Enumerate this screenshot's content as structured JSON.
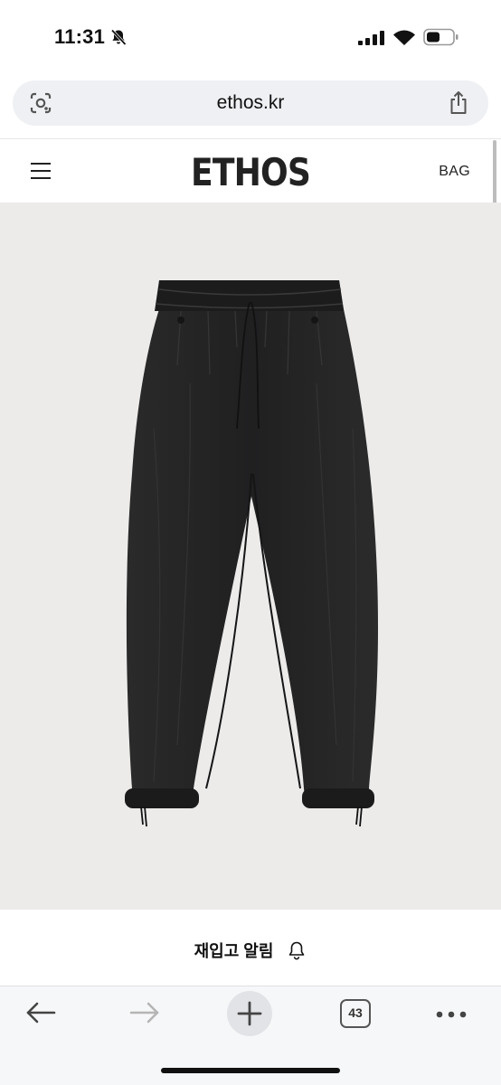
{
  "status_bar": {
    "time": "11:31"
  },
  "browser": {
    "url": "ethos.kr",
    "open_tabs": "43"
  },
  "site": {
    "logo": "ETHOS",
    "bag_label": "BAG"
  },
  "product": {
    "restock_label": "재입고 알림"
  },
  "colors": {
    "product_bg": "#ecebea",
    "toolbar_bg": "#f6f7f8",
    "url_bar_bg": "#eef0f3"
  },
  "icons": [
    "bell-off-icon",
    "signal-icon",
    "wifi-icon",
    "battery-icon",
    "lens-icon",
    "share-icon",
    "hamburger-icon",
    "bell-icon",
    "back-arrow-icon",
    "forward-arrow-icon",
    "plus-icon",
    "more-icon"
  ]
}
